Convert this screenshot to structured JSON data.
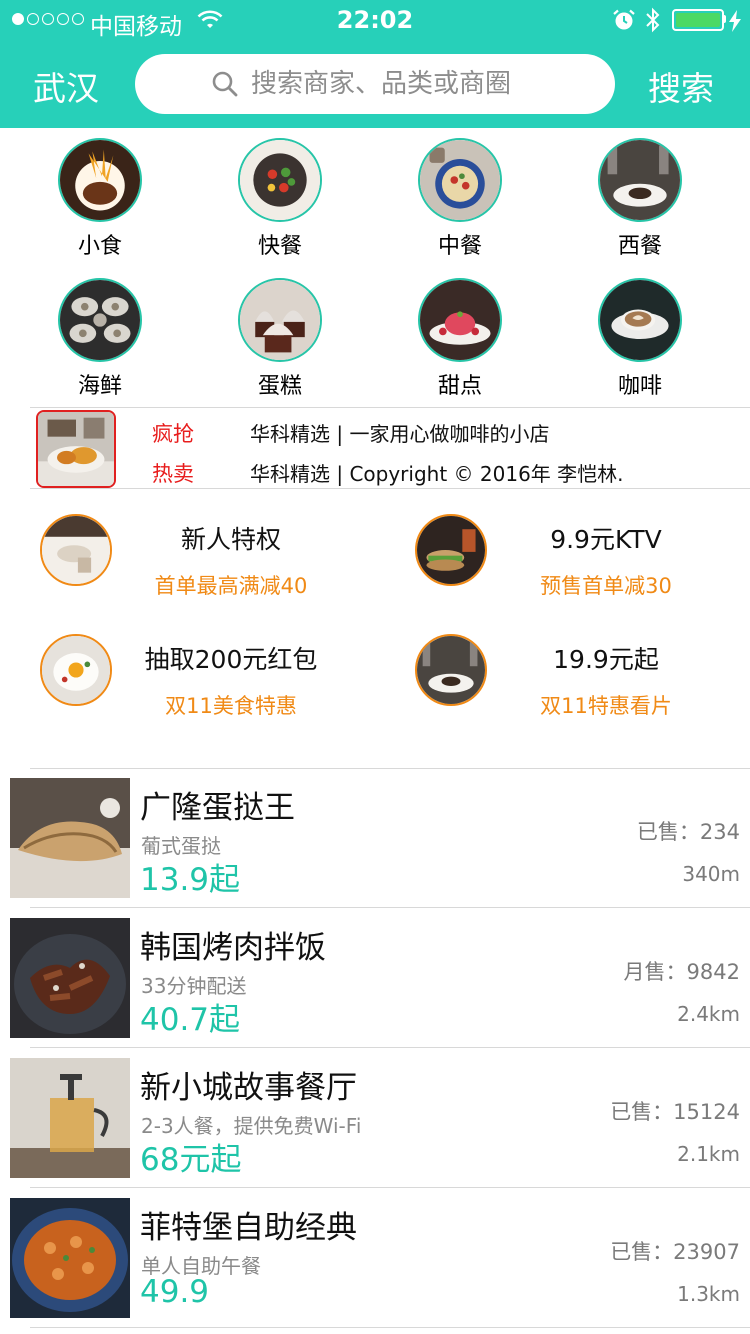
{
  "status_bar": {
    "carrier": "中国移动",
    "time": "22:02",
    "battery_color": "#4cd964"
  },
  "header": {
    "city": "武汉",
    "search_placeholder": "搜索商家、品类或商圈",
    "search_button": "搜索",
    "accent_color": "#27d0b9",
    "icons": [
      "search-icon",
      "wifi-icon",
      "alarm-icon",
      "bluetooth-icon",
      "battery-icon"
    ]
  },
  "categories": [
    {
      "label": "小食"
    },
    {
      "label": "快餐"
    },
    {
      "label": "中餐"
    },
    {
      "label": "西餐"
    },
    {
      "label": "海鲜"
    },
    {
      "label": "蛋糕"
    },
    {
      "label": "甜点"
    },
    {
      "label": "咖啡"
    }
  ],
  "ticker": {
    "tags": [
      "疯抢",
      "热卖"
    ],
    "lines": [
      "华科精选 | 一家用心做咖啡的小店",
      "华科精选 | Copyright © 2016年 李恺林."
    ]
  },
  "promos": [
    {
      "title": "新人特权",
      "subtitle": "首单最高满减40"
    },
    {
      "title": "9.9元KTV",
      "subtitle": "预售首单减30"
    },
    {
      "title": "抽取200元红包",
      "subtitle": "双11美食特惠"
    },
    {
      "title": "19.9元起",
      "subtitle": "双11特惠看片"
    }
  ],
  "shops": [
    {
      "name": "广隆蛋挞王",
      "desc": "葡式蛋挞",
      "price": "13.9起",
      "sold": "已售：234",
      "distance": "340m"
    },
    {
      "name": "韩国烤肉拌饭",
      "desc": "33分钟配送",
      "price": "40.7起",
      "sold": "月售：9842",
      "distance": "2.4km"
    },
    {
      "name": "新小城故事餐厅",
      "desc": "2-3人餐，提供免费Wi-Fi",
      "price": "68元起",
      "sold": "已售：15124",
      "distance": "2.1km"
    },
    {
      "name": "菲特堡自助经典",
      "desc": "单人自助午餐",
      "price": "49.9",
      "sold": "已售：23907",
      "distance": "1.3km"
    }
  ]
}
